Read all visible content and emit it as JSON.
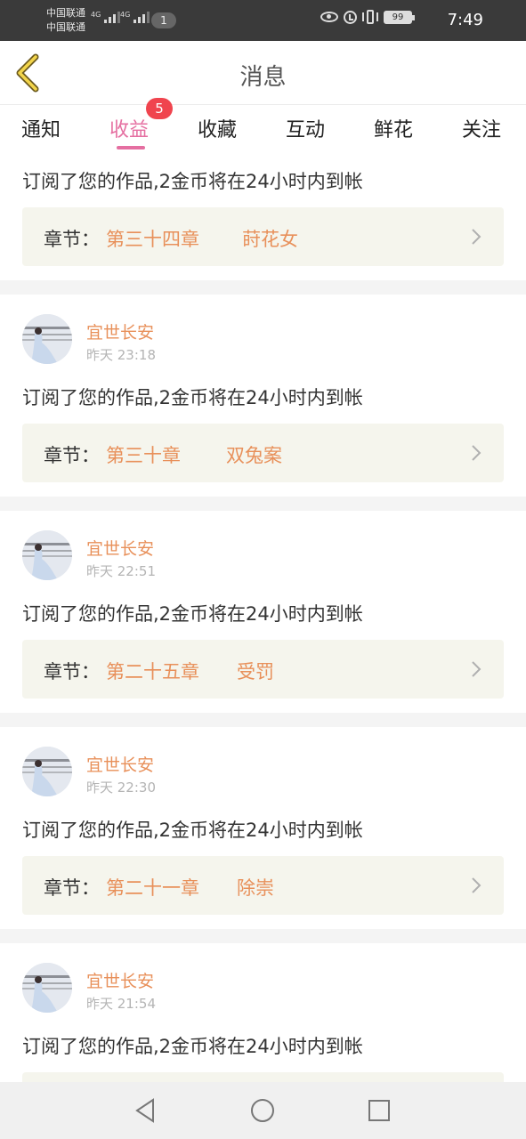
{
  "status_bar": {
    "carrier1": "中国联通",
    "carrier2": "中国联通",
    "net1": "4G",
    "net2": "4G",
    "notification_count": "1",
    "battery": "99",
    "time": "7:49"
  },
  "header": {
    "title": "消息",
    "back_icon": "chevron-left-icon"
  },
  "tabs": [
    {
      "label": "通知"
    },
    {
      "label": "收益",
      "badge": "5"
    },
    {
      "label": "收藏"
    },
    {
      "label": "互动"
    },
    {
      "label": "鲜花"
    },
    {
      "label": "关注"
    }
  ],
  "active_tab": "收益",
  "accent_color": "#e56fa1",
  "name_color": "#e8905a",
  "items": [
    {
      "message": "订阅了您的作品,2金币将在24小时内到帐",
      "chapter_label": "章节：",
      "chapter_num": "第三十四章",
      "chapter_name": "莳花女"
    },
    {
      "user": "宜世长安",
      "time": "昨天 23:18",
      "message": "订阅了您的作品,2金币将在24小时内到帐",
      "chapter_label": "章节：",
      "chapter_num": "第三十章",
      "chapter_name": "双兔案"
    },
    {
      "user": "宜世长安",
      "time": "昨天 22:51",
      "message": "订阅了您的作品,2金币将在24小时内到帐",
      "chapter_label": "章节：",
      "chapter_num": "第二十五章",
      "chapter_name": "受罚"
    },
    {
      "user": "宜世长安",
      "time": "昨天 22:30",
      "message": "订阅了您的作品,2金币将在24小时内到帐",
      "chapter_label": "章节：",
      "chapter_num": "第二十一章",
      "chapter_name": "除崇"
    },
    {
      "user": "宜世长安",
      "time": "昨天 21:54",
      "message": "订阅了您的作品,2金币将在24小时内到帐"
    }
  ],
  "nav_bar": {
    "back": "triangle-back-icon",
    "home": "circle-home-icon",
    "recents": "square-recents-icon"
  }
}
